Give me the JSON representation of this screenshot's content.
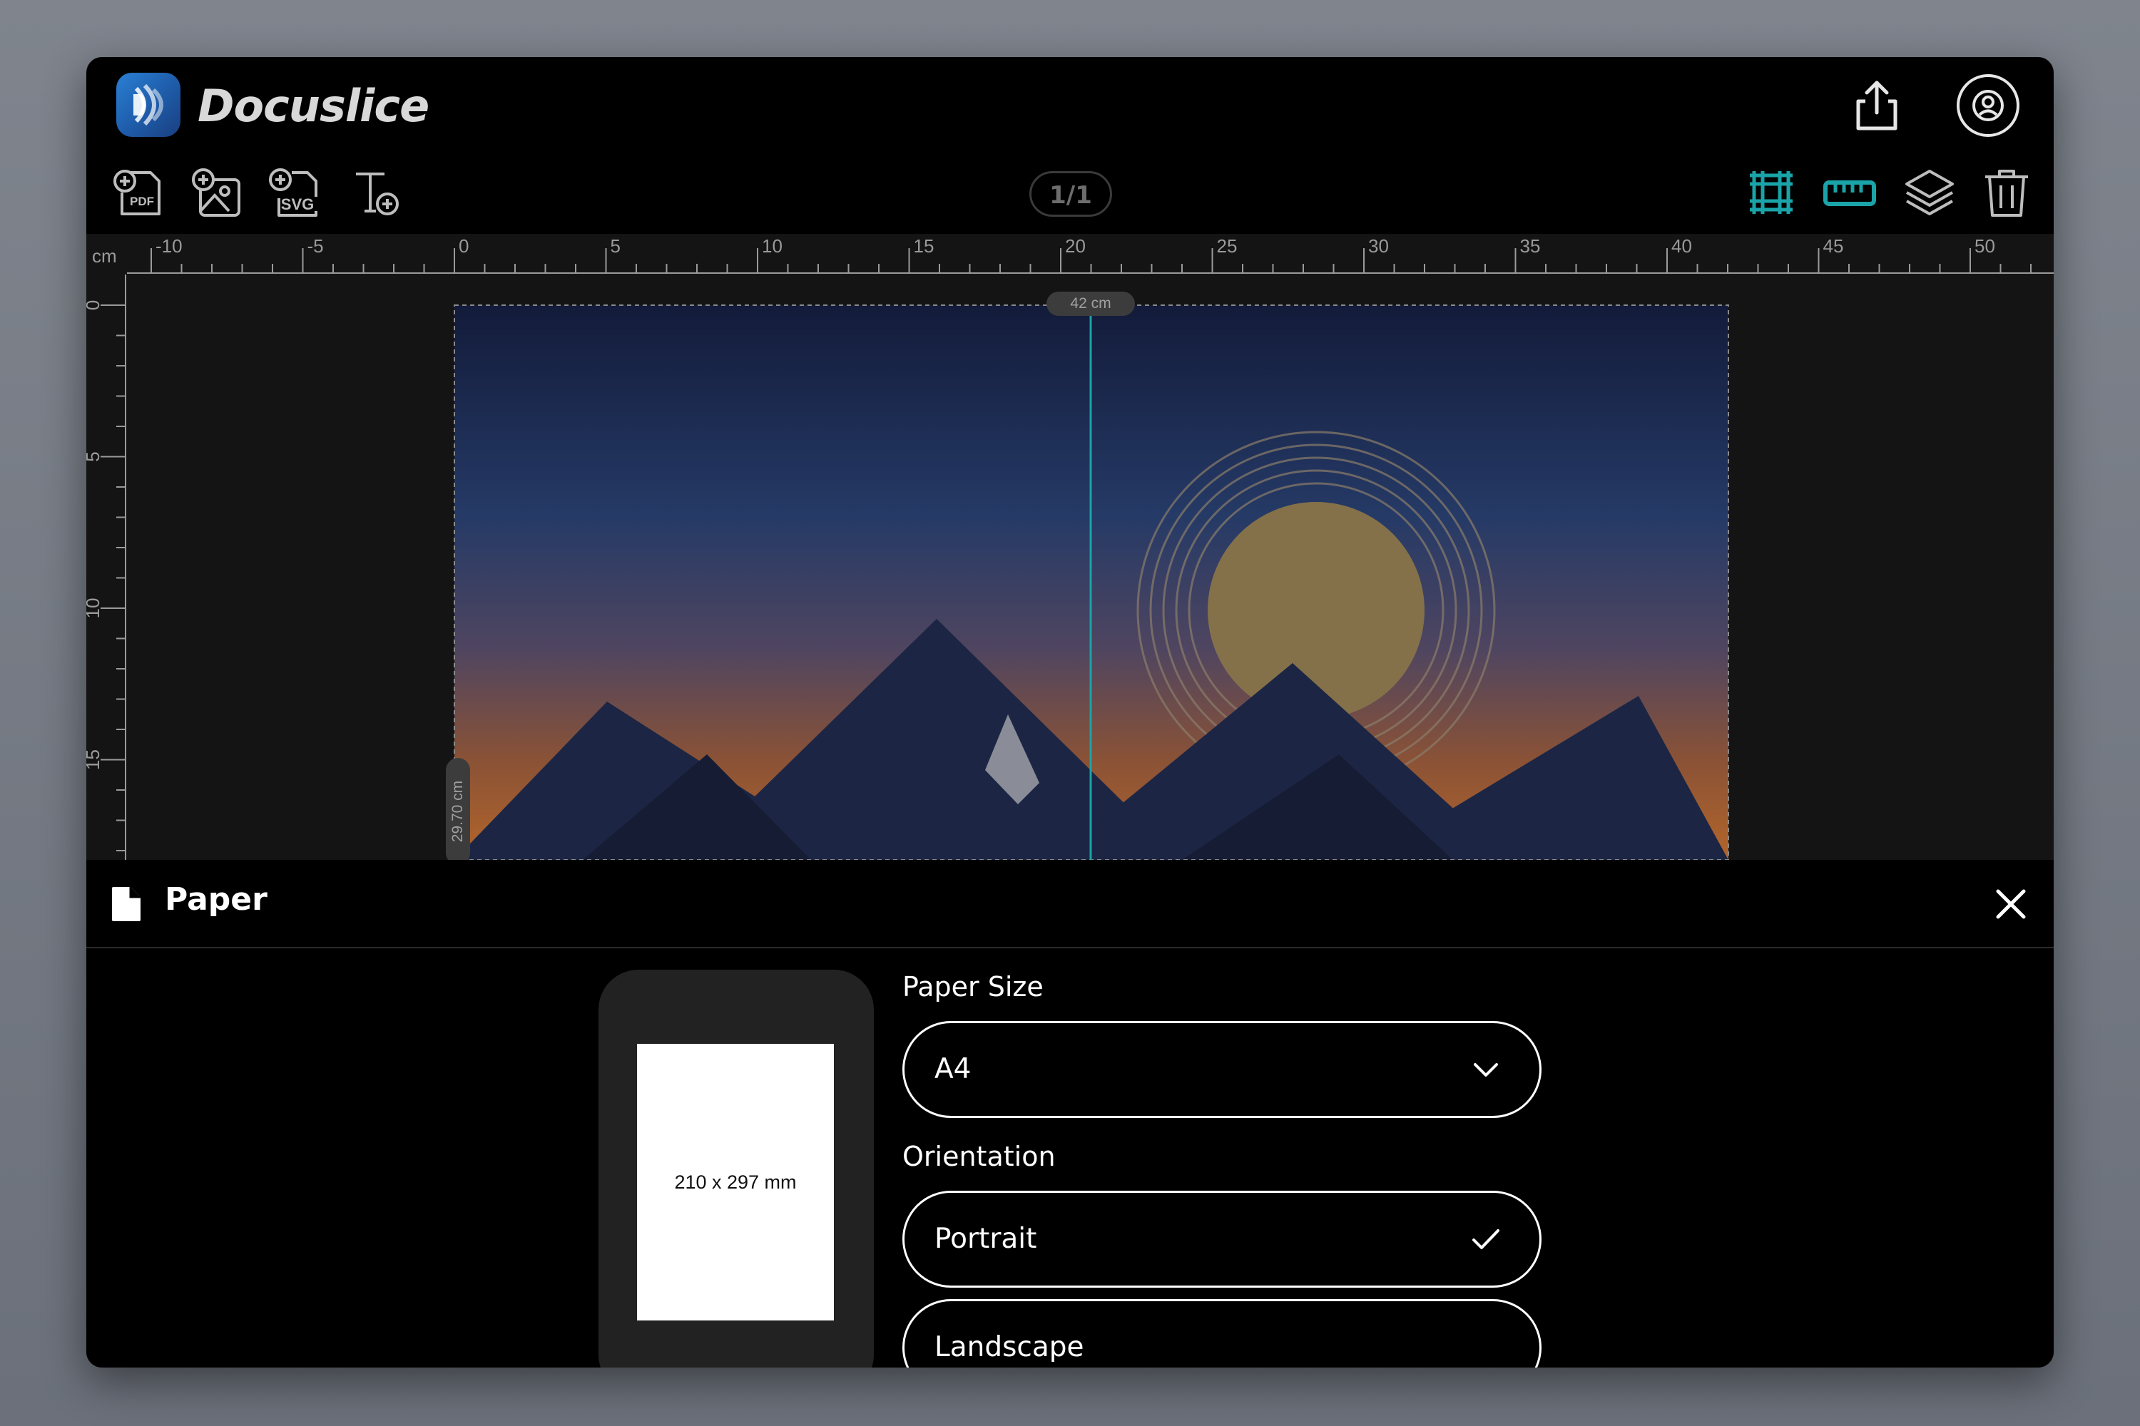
{
  "app": {
    "name": "Docuslice"
  },
  "toolbar": {
    "add_pdf_badge": "PDF",
    "add_svg_badge": "SVG",
    "page_indicator": "1/1"
  },
  "ruler": {
    "unit": "cm",
    "horizontal_ticks": [
      "-10",
      "-5",
      "0",
      "5",
      "10",
      "15",
      "20",
      "25",
      "30",
      "35",
      "40",
      "45",
      "50"
    ],
    "vertical_ticks": [
      "0",
      "5",
      "10",
      "15"
    ],
    "width_label": "42 cm",
    "height_label": "29.70 cm"
  },
  "colors": {
    "accent": "#1aa3a8",
    "background": "#000000"
  },
  "panel": {
    "title": "Paper",
    "preview_label": "210 x 297 mm",
    "paper_size_label": "Paper Size",
    "paper_size_value": "A4",
    "orientation_label": "Orientation",
    "orientation_options": [
      {
        "label": "Portrait",
        "selected": true
      },
      {
        "label": "Landscape",
        "selected": false
      }
    ]
  }
}
